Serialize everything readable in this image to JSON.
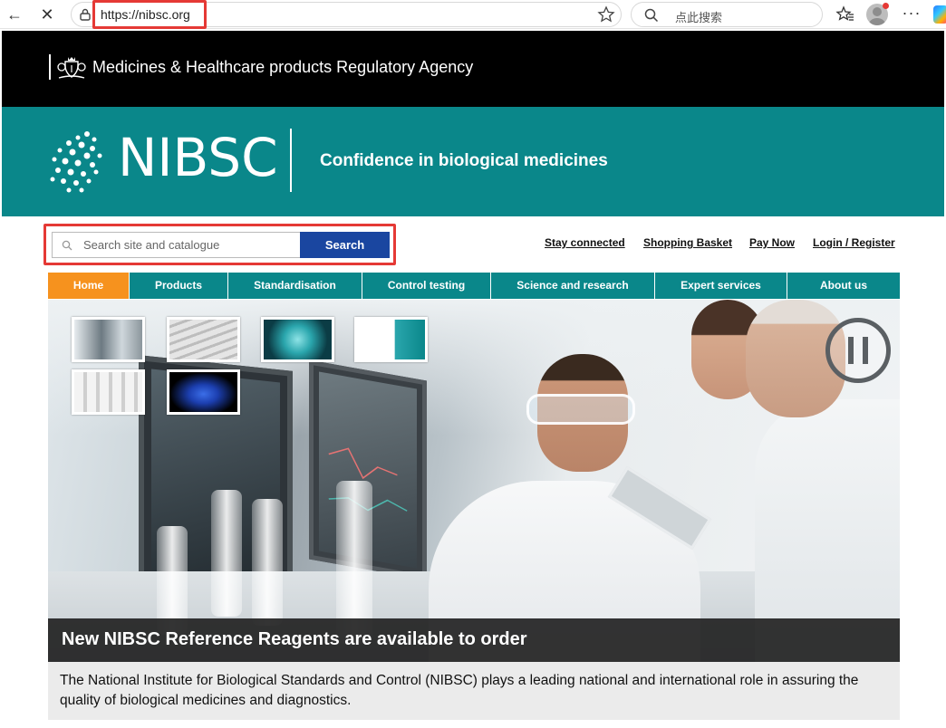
{
  "browser": {
    "url": "https://nibsc.org",
    "search_placeholder": "点此搜索",
    "back_glyph": "←",
    "close_glyph": "✕",
    "more_glyph": "···"
  },
  "header": {
    "agency_name": "Medicines & Healthcare products Regulatory Agency",
    "brand": "NIBSC",
    "tagline": "Confidence in biological medicines"
  },
  "search": {
    "placeholder": "Search site and catalogue",
    "button_label": "Search"
  },
  "utility_links": [
    "Stay connected",
    "Shopping Basket",
    "Pay Now",
    "Login / Register"
  ],
  "nav": {
    "items": [
      "Home",
      "Products",
      "Standardisation",
      "Control testing",
      "Science and research",
      "Expert services",
      "About us"
    ],
    "active": "Home"
  },
  "hero": {
    "caption": "New NIBSC Reference Reagents are available to order"
  },
  "intro": {
    "text": "The National Institute for Biological Standards and Control (NIBSC) plays a leading national and international role in assuring the quality of biological medicines and diagnostics."
  },
  "colors": {
    "teal": "#0a878a",
    "orange": "#f6921e",
    "search_blue": "#1a46a0",
    "highlight_red": "#e53935"
  }
}
